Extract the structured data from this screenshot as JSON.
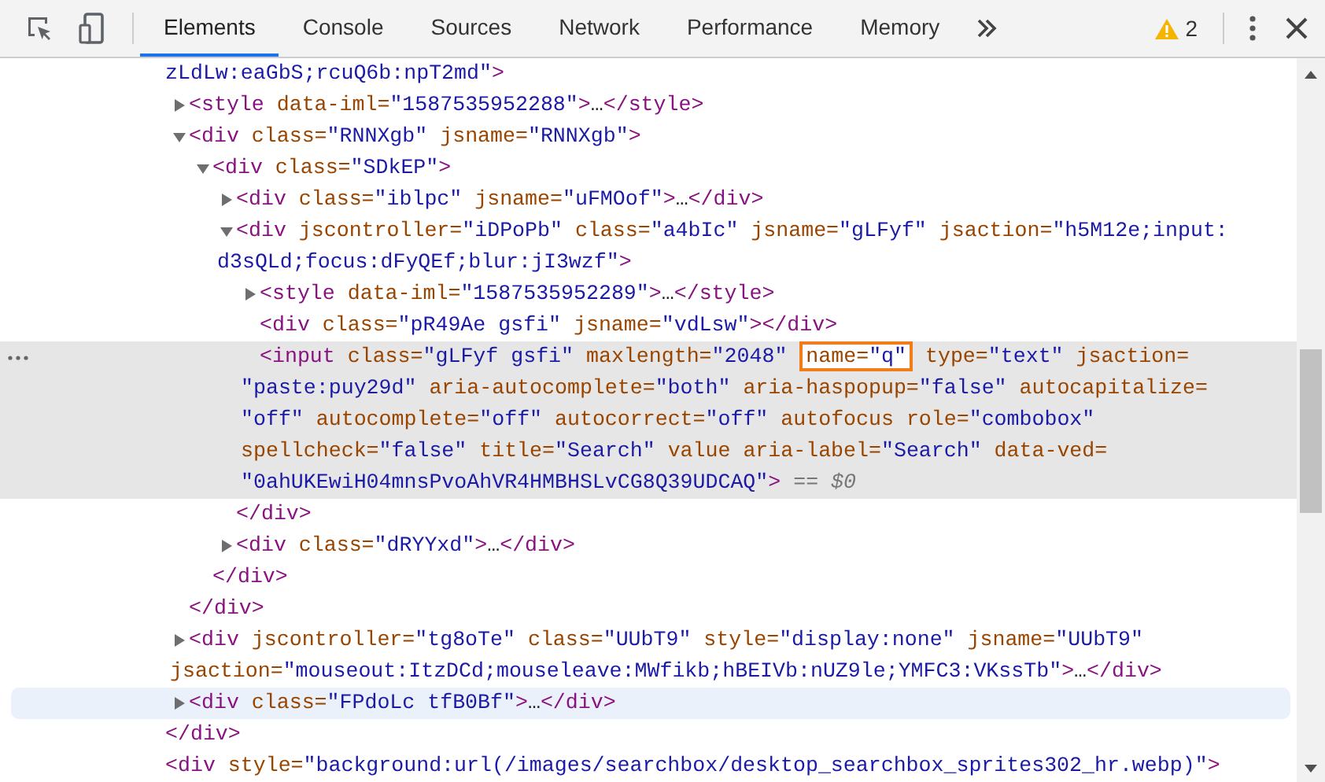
{
  "toolbar": {
    "tabs": [
      {
        "label": "Elements",
        "selected": true
      },
      {
        "label": "Console",
        "selected": false
      },
      {
        "label": "Sources",
        "selected": false
      },
      {
        "label": "Network",
        "selected": false
      },
      {
        "label": "Performance",
        "selected": false
      },
      {
        "label": "Memory",
        "selected": false
      }
    ],
    "warnings": "2"
  },
  "tree": [
    {
      "selected": false,
      "hovered": false,
      "lines": [
        [
          {
            "kind": "value",
            "text": "zLdLw:eaGbS;rcuQ6b:npT2md\""
          },
          {
            "kind": "tag",
            "text": ">"
          }
        ]
      ],
      "children": [
        {
          "expanded": false,
          "selected": false,
          "hovered": false,
          "lines": [
            [
              {
                "kind": "tag",
                "text": "<style"
              },
              {
                "kind": "attr",
                "text": " data-iml="
              },
              {
                "kind": "value",
                "text": "\"1587535952288\""
              },
              {
                "kind": "tag",
                "text": ">"
              },
              {
                "kind": "text",
                "text": "…"
              },
              {
                "kind": "tag",
                "text": "</style>"
              }
            ]
          ]
        },
        {
          "expanded": true,
          "selected": false,
          "hovered": false,
          "lines": [
            [
              {
                "kind": "tag",
                "text": "<div"
              },
              {
                "kind": "attr",
                "text": " class="
              },
              {
                "kind": "value",
                "text": "\"RNNXgb\""
              },
              {
                "kind": "attr",
                "text": " jsname="
              },
              {
                "kind": "value",
                "text": "\"RNNXgb\""
              },
              {
                "kind": "tag",
                "text": ">"
              }
            ]
          ],
          "children": [
            {
              "expanded": true,
              "selected": false,
              "hovered": false,
              "lines": [
                [
                  {
                    "kind": "tag",
                    "text": "<div"
                  },
                  {
                    "kind": "attr",
                    "text": " class="
                  },
                  {
                    "kind": "value",
                    "text": "\"SDkEP\""
                  },
                  {
                    "kind": "tag",
                    "text": ">"
                  }
                ]
              ],
              "children": [
                {
                  "expanded": false,
                  "selected": false,
                  "hovered": false,
                  "lines": [
                    [
                      {
                        "kind": "tag",
                        "text": "<div"
                      },
                      {
                        "kind": "attr",
                        "text": " class="
                      },
                      {
                        "kind": "value",
                        "text": "\"iblpc\""
                      },
                      {
                        "kind": "attr",
                        "text": " jsname="
                      },
                      {
                        "kind": "value",
                        "text": "\"uFMOof\""
                      },
                      {
                        "kind": "tag",
                        "text": ">"
                      },
                      {
                        "kind": "text",
                        "text": "…"
                      },
                      {
                        "kind": "tag",
                        "text": "</div>"
                      }
                    ]
                  ]
                },
                {
                  "expanded": true,
                  "selected": false,
                  "hovered": false,
                  "lines": [
                    [
                      {
                        "kind": "tag",
                        "text": "<div"
                      },
                      {
                        "kind": "attr",
                        "text": " jscontroller="
                      },
                      {
                        "kind": "value",
                        "text": "\"iDPoPb\""
                      },
                      {
                        "kind": "attr",
                        "text": " class="
                      },
                      {
                        "kind": "value",
                        "text": "\"a4bIc\""
                      },
                      {
                        "kind": "attr",
                        "text": " jsname="
                      },
                      {
                        "kind": "value",
                        "text": "\"gLFyf\""
                      },
                      {
                        "kind": "attr",
                        "text": " jsaction="
                      },
                      {
                        "kind": "value",
                        "text": "\"h5M12e;input:"
                      }
                    ],
                    [
                      {
                        "kind": "value",
                        "text": "d3sQLd;focus:dFyQEf;blur:jI3wzf\""
                      },
                      {
                        "kind": "tag",
                        "text": ">"
                      }
                    ]
                  ],
                  "children": [
                    {
                      "expanded": false,
                      "selected": false,
                      "hovered": false,
                      "lines": [
                        [
                          {
                            "kind": "tag",
                            "text": "<style"
                          },
                          {
                            "kind": "attr",
                            "text": " data-iml="
                          },
                          {
                            "kind": "value",
                            "text": "\"1587535952289\""
                          },
                          {
                            "kind": "tag",
                            "text": ">"
                          },
                          {
                            "kind": "text",
                            "text": "…"
                          },
                          {
                            "kind": "tag",
                            "text": "</style>"
                          }
                        ]
                      ]
                    },
                    {
                      "selected": false,
                      "hovered": false,
                      "lines": [
                        [
                          {
                            "kind": "tag",
                            "text": "<div"
                          },
                          {
                            "kind": "attr",
                            "text": " class="
                          },
                          {
                            "kind": "value",
                            "text": "\"pR49Ae gsfi\""
                          },
                          {
                            "kind": "attr",
                            "text": " jsname="
                          },
                          {
                            "kind": "value",
                            "text": "\"vdLsw\""
                          },
                          {
                            "kind": "tag",
                            "text": "></div>"
                          }
                        ]
                      ]
                    },
                    {
                      "selected": true,
                      "hovered": false,
                      "lines": [
                        [
                          {
                            "kind": "tag",
                            "text": "<input"
                          },
                          {
                            "kind": "attr",
                            "text": " class="
                          },
                          {
                            "kind": "value",
                            "text": "\"gLFyf gsfi\""
                          },
                          {
                            "kind": "attr",
                            "text": " maxlength="
                          },
                          {
                            "kind": "value",
                            "text": "\"2048\" "
                          },
                          {
                            "kind": "attr",
                            "text": "name=",
                            "outlined": true
                          },
                          {
                            "kind": "value",
                            "text": "\"q\"",
                            "outlined": true
                          },
                          {
                            "kind": "attr",
                            "text": " type="
                          },
                          {
                            "kind": "value",
                            "text": "\"text\""
                          },
                          {
                            "kind": "attr",
                            "text": " jsaction="
                          }
                        ],
                        [
                          {
                            "kind": "value",
                            "text": "\"paste:puy29d\""
                          },
                          {
                            "kind": "attr",
                            "text": " aria-autocomplete="
                          },
                          {
                            "kind": "value",
                            "text": "\"both\""
                          },
                          {
                            "kind": "attr",
                            "text": " aria-haspopup="
                          },
                          {
                            "kind": "value",
                            "text": "\"false\""
                          },
                          {
                            "kind": "attr",
                            "text": " autocapitalize="
                          }
                        ],
                        [
                          {
                            "kind": "value",
                            "text": "\"off\""
                          },
                          {
                            "kind": "attr",
                            "text": " autocomplete="
                          },
                          {
                            "kind": "value",
                            "text": "\"off\""
                          },
                          {
                            "kind": "attr",
                            "text": " autocorrect="
                          },
                          {
                            "kind": "value",
                            "text": "\"off\""
                          },
                          {
                            "kind": "attr",
                            "text": " autofocus role="
                          },
                          {
                            "kind": "value",
                            "text": "\"combobox\""
                          }
                        ],
                        [
                          {
                            "kind": "attr",
                            "text": "spellcheck="
                          },
                          {
                            "kind": "value",
                            "text": "\"false\""
                          },
                          {
                            "kind": "attr",
                            "text": " title="
                          },
                          {
                            "kind": "value",
                            "text": "\"Search\""
                          },
                          {
                            "kind": "attr",
                            "text": " value aria-label="
                          },
                          {
                            "kind": "value",
                            "text": "\"Search\""
                          },
                          {
                            "kind": "attr",
                            "text": " data-ved="
                          }
                        ],
                        [
                          {
                            "kind": "value",
                            "text": "\"0ahUKEwiH04mnsPvoAhVR4HMBHSLvCG8Q39UDCAQ\""
                          },
                          {
                            "kind": "tag",
                            "text": ">"
                          },
                          {
                            "kind": "note",
                            "text": " == $0"
                          }
                        ]
                      ]
                    }
                  ],
                  "closing": [
                    {
                      "kind": "tag",
                      "text": "</div>"
                    }
                  ]
                },
                {
                  "expanded": false,
                  "selected": false,
                  "hovered": false,
                  "lines": [
                    [
                      {
                        "kind": "tag",
                        "text": "<div"
                      },
                      {
                        "kind": "attr",
                        "text": " class="
                      },
                      {
                        "kind": "value",
                        "text": "\"dRYYxd\""
                      },
                      {
                        "kind": "tag",
                        "text": ">"
                      },
                      {
                        "kind": "text",
                        "text": "…"
                      },
                      {
                        "kind": "tag",
                        "text": "</div>"
                      }
                    ]
                  ]
                }
              ],
              "closing": [
                {
                  "kind": "tag",
                  "text": "</div>"
                }
              ]
            }
          ],
          "closing": [
            {
              "kind": "tag",
              "text": "</div>"
            }
          ]
        },
        {
          "expanded": false,
          "selected": false,
          "hovered": false,
          "lines": [
            [
              {
                "kind": "tag",
                "text": "<div"
              },
              {
                "kind": "attr",
                "text": " jscontroller="
              },
              {
                "kind": "value",
                "text": "\"tg8oTe\""
              },
              {
                "kind": "attr",
                "text": " class="
              },
              {
                "kind": "value",
                "text": "\"UUbT9\""
              },
              {
                "kind": "attr",
                "text": " style="
              },
              {
                "kind": "value",
                "text": "\"display:none\""
              },
              {
                "kind": "attr",
                "text": " jsname="
              },
              {
                "kind": "value",
                "text": "\"UUbT9\""
              }
            ],
            [
              {
                "kind": "attr",
                "text": "jsaction="
              },
              {
                "kind": "value",
                "text": "\"mouseout:ItzDCd;mouseleave:MWfikb;hBEIVb:nUZ9le;YMFC3:VKssTb\""
              },
              {
                "kind": "tag",
                "text": ">"
              },
              {
                "kind": "text",
                "text": "…"
              },
              {
                "kind": "tag",
                "text": "</div>"
              }
            ]
          ]
        },
        {
          "expanded": false,
          "selected": false,
          "hovered": true,
          "lines": [
            [
              {
                "kind": "tag",
                "text": "<div"
              },
              {
                "kind": "attr",
                "text": " class="
              },
              {
                "kind": "value",
                "text": "\"FPdoLc tfB0Bf\""
              },
              {
                "kind": "tag",
                "text": ">"
              },
              {
                "kind": "text",
                "text": "…"
              },
              {
                "kind": "tag",
                "text": "</div>"
              }
            ]
          ]
        }
      ],
      "closing": [
        {
          "kind": "tag",
          "text": "</div>"
        }
      ]
    },
    {
      "selected": false,
      "hovered": false,
      "lines": [
        [
          {
            "kind": "tag",
            "text": "<div"
          },
          {
            "kind": "attr",
            "text": " style="
          },
          {
            "kind": "value",
            "text": "\"background:url(/images/searchbox/desktop_searchbox_sprites302_hr.webp)\""
          },
          {
            "kind": "tag",
            "text": ">"
          }
        ]
      ]
    }
  ]
}
